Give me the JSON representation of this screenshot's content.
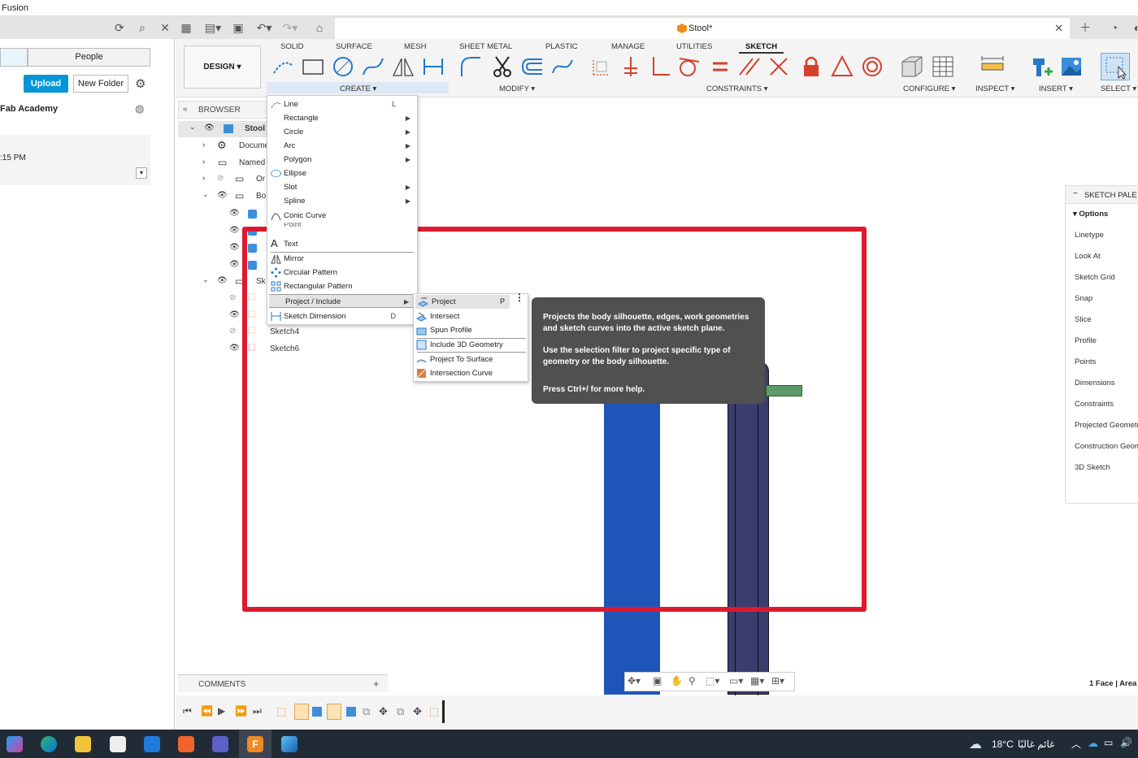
{
  "app": {
    "title": "Fusion"
  },
  "tab": {
    "doc_title": "Stool*"
  },
  "left": {
    "people_tab": "People",
    "upload_label": "Upload",
    "new_folder_label": "New Folder",
    "project_name": "Fab Academy",
    "time_text": ":15 PM"
  },
  "ribbon": {
    "design_label": "DESIGN",
    "tabs": [
      "SOLID",
      "SURFACE",
      "MESH",
      "SHEET METAL",
      "PLASTIC",
      "MANAGE",
      "UTILITIES",
      "SKETCH"
    ],
    "groups": {
      "create": "CREATE",
      "modify": "MODIFY",
      "constraints": "CONSTRAINTS",
      "configure": "CONFIGURE",
      "inspect": "INSPECT",
      "insert": "INSERT",
      "select": "SELECT"
    }
  },
  "browser": {
    "title": "BROWSER",
    "root": "Stool",
    "items": [
      "Docume",
      "Named V",
      "Or",
      "Bo",
      "Sk"
    ],
    "sketches": [
      "Sketch4",
      "Sketch6"
    ]
  },
  "create_menu": {
    "items": [
      {
        "label": "Line",
        "shortcut": "L"
      },
      {
        "label": "Rectangle"
      },
      {
        "label": "Circle"
      },
      {
        "label": "Arc"
      },
      {
        "label": "Polygon"
      },
      {
        "label": "Ellipse"
      },
      {
        "label": "Slot"
      },
      {
        "label": "Spline"
      },
      {
        "label": "Conic Curve"
      },
      {
        "label": "Point"
      },
      {
        "label": "Text"
      },
      {
        "label": "Mirror"
      },
      {
        "label": "Circular Pattern"
      },
      {
        "label": "Rectangular Pattern"
      },
      {
        "label": "Project / Include"
      },
      {
        "label": "Sketch Dimension",
        "shortcut": "D"
      }
    ]
  },
  "project_submenu": {
    "items": [
      {
        "label": "Project",
        "shortcut": "P"
      },
      {
        "label": "Intersect"
      },
      {
        "label": "Spun Profile"
      },
      {
        "label": "Include 3D Geometry"
      },
      {
        "label": "Project To Surface"
      },
      {
        "label": "Intersection Curve"
      }
    ]
  },
  "tooltip": {
    "line1": "Projects the body silhouette, edges, work geometries and sketch curves into the active sketch plane.",
    "line2": "Use the selection filter to project specific type of geometry or the body silhouette.",
    "line3": "Press Ctrl+/ for more help."
  },
  "palette": {
    "title": "SKETCH PALE",
    "options_label": "Options",
    "items": [
      "Linetype",
      "Look At",
      "Sketch Grid",
      "Snap",
      "Slice",
      "Profile",
      "Points",
      "Dimensions",
      "Constraints",
      "Projected Geometri",
      "Construction Geom",
      "3D Sketch"
    ]
  },
  "comments": {
    "label": "COMMENTS"
  },
  "status": {
    "selection": "1 Face | Area"
  },
  "taskbar": {
    "temperature": "18°C",
    "weather": "غائم غالبًا"
  },
  "colors": {
    "accent": "#0696d7",
    "highlight_box": "#e0182d",
    "body_blue": "#1f55b8",
    "body_navy": "#3a3d6e",
    "tooltip_bg": "#505050"
  }
}
